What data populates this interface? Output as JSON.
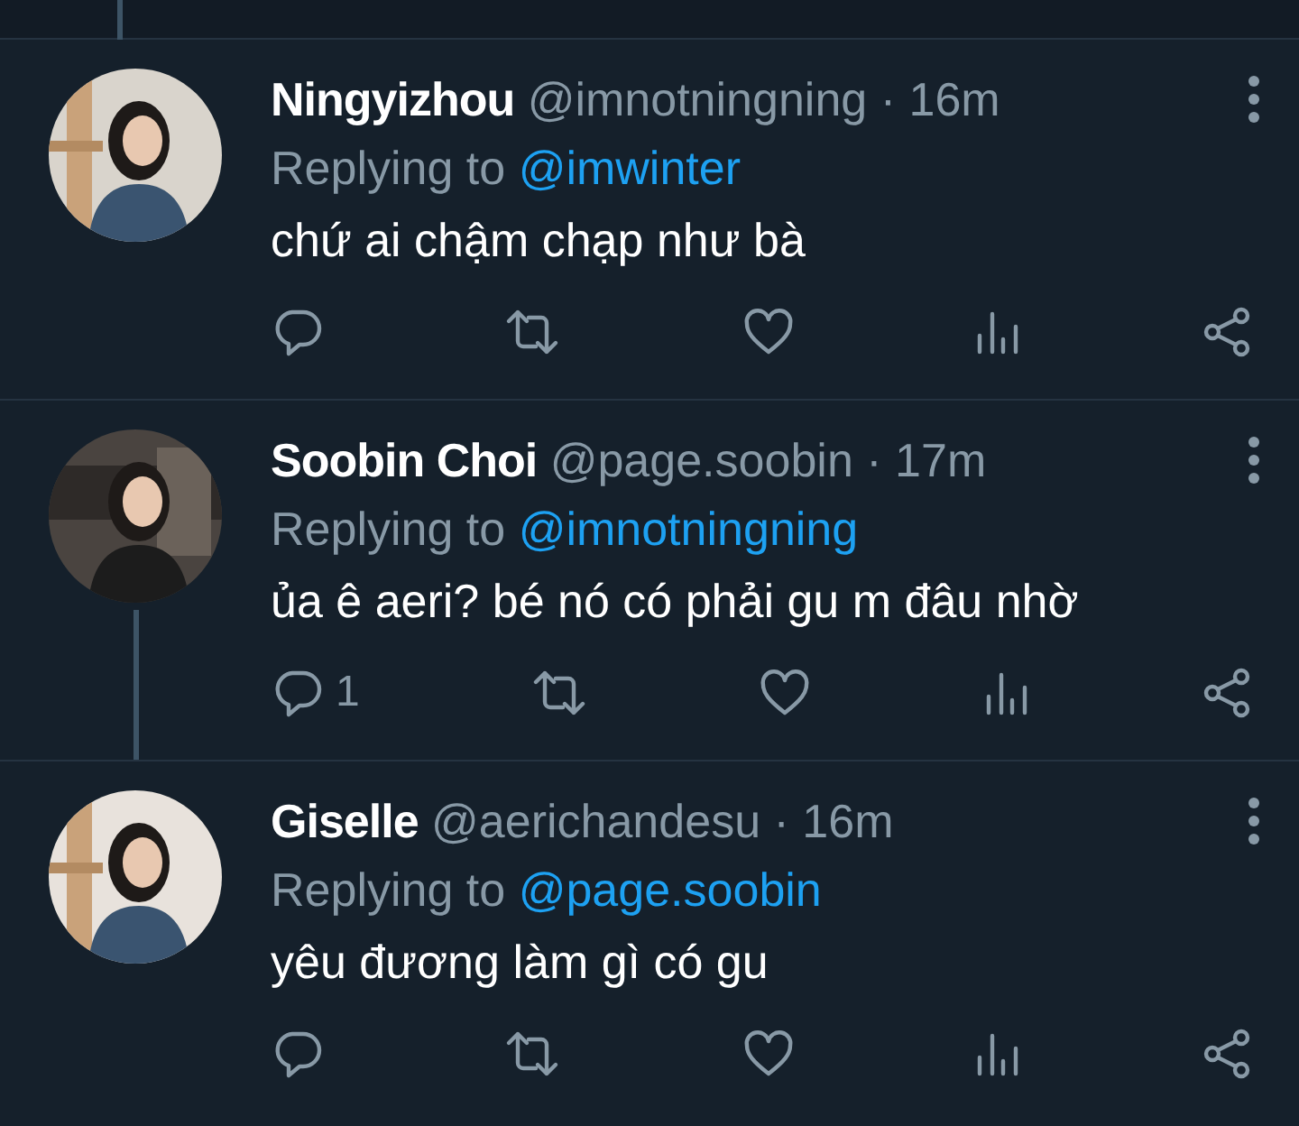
{
  "tweets": [
    {
      "name": "Ningyizhou",
      "handle": "@imnotningning",
      "time": "· 16m",
      "replying_label": "Replying to",
      "reply_to": "@imwinter",
      "text": "chứ ai chậm chạp như bà",
      "thread_below": false
    },
    {
      "name": "Soobin Choi",
      "handle": "@page.soobin",
      "time": "· 17m",
      "replying_label": "Replying to",
      "reply_to": "@imnotningning",
      "text": "ủa ê aeri? bé nó có phải gu m đâu nhờ",
      "reply_count": "1",
      "thread_below": true
    },
    {
      "name": "Giselle",
      "handle": "@aerichandesu",
      "time": "· 16m",
      "replying_label": "Replying to",
      "reply_to": "@page.soobin",
      "text": "yêu đương làm gì có gu",
      "thread_below": false
    }
  ]
}
